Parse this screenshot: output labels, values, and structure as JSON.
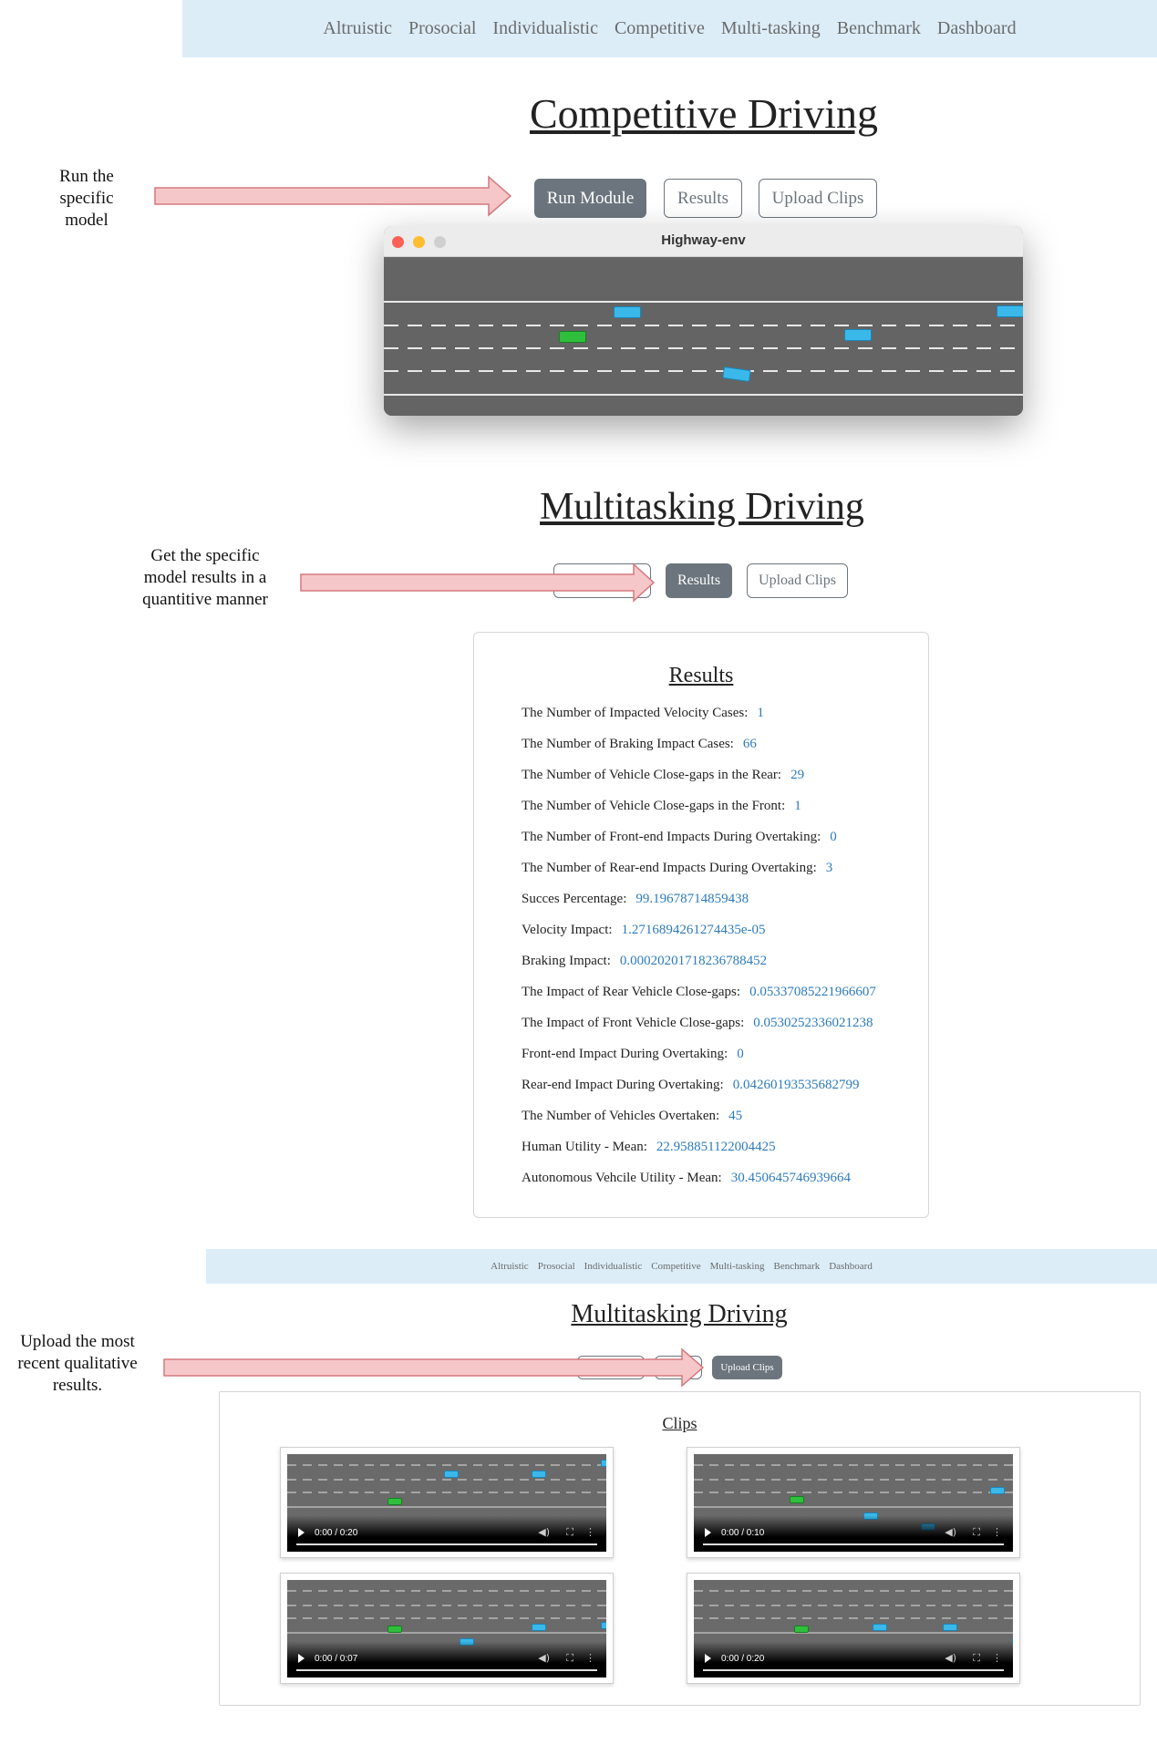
{
  "nav": {
    "items": [
      "Altruistic",
      "Prosocial",
      "Individualistic",
      "Competitive",
      "Multi-tasking",
      "Benchmark",
      "Dashboard"
    ]
  },
  "section1": {
    "title": "Competitive Driving",
    "buttons": {
      "run": "Run Module",
      "results": "Results",
      "upload": "Upload Clips"
    },
    "annotation": "Run the specific model",
    "window": {
      "title": "Highway-env"
    }
  },
  "section2": {
    "title": "Multitasking Driving",
    "buttons": {
      "results": "Results",
      "upload": "Upload Clips"
    },
    "annotation": "Get the specific model results in a quantitive manner",
    "results_title": "Results",
    "results": [
      {
        "label": "The Number of Impacted Velocity Cases:",
        "value": "1"
      },
      {
        "label": "The Number of Braking Impact Cases:",
        "value": "66"
      },
      {
        "label": "The Number of Vehicle Close-gaps in the Rear:",
        "value": "29"
      },
      {
        "label": "The Number of Vehicle Close-gaps in the Front:",
        "value": "1"
      },
      {
        "label": "The Number of Front-end Impacts During Overtaking:",
        "value": "0"
      },
      {
        "label": "The Number of Rear-end Impacts During Overtaking:",
        "value": "3"
      },
      {
        "label": "Succes Percentage:",
        "value": "99.19678714859438"
      },
      {
        "label": "Velocity Impact:",
        "value": "1.2716894261274435e-05"
      },
      {
        "label": "Braking Impact:",
        "value": "0.00020201718236788452"
      },
      {
        "label": "The Impact of Rear Vehicle Close-gaps:",
        "value": "0.05337085221966607"
      },
      {
        "label": "The Impact of Front Vehicle Close-gaps:",
        "value": "0.0530252336021238"
      },
      {
        "label": "Front-end Impact During Overtaking:",
        "value": "0"
      },
      {
        "label": "Rear-end Impact During Overtaking:",
        "value": "0.04260193535682799"
      },
      {
        "label": "The Number of Vehicles Overtaken:",
        "value": "45"
      },
      {
        "label": "Human Utility - Mean:",
        "value": "22.958851122004425"
      },
      {
        "label": "Autonomous Vehcile Utility - Mean:",
        "value": "30.450645746939664"
      }
    ]
  },
  "section3": {
    "title": "Multitasking Driving",
    "buttons": {
      "upload": "Upload Clips"
    },
    "annotation": "Upload the most recent qualitative results.",
    "clips_title": "Clips",
    "clips": [
      {
        "time": "0:00 / 0:20"
      },
      {
        "time": "0:00 / 0:10"
      },
      {
        "time": "0:00 / 0:07"
      },
      {
        "time": "0:00 / 0:20"
      }
    ]
  },
  "colors": {
    "accent": "#6c757d",
    "link_value": "#2d7bbb",
    "nav_bg": "#dcedf8",
    "arrow_fill": "#f6c7c9",
    "arrow_stroke": "#d47a7f"
  },
  "icons": [
    "play-icon",
    "volume-icon",
    "fullscreen-icon",
    "more-options-icon",
    "close-window-icon",
    "minimize-window-icon",
    "zoom-window-icon"
  ]
}
